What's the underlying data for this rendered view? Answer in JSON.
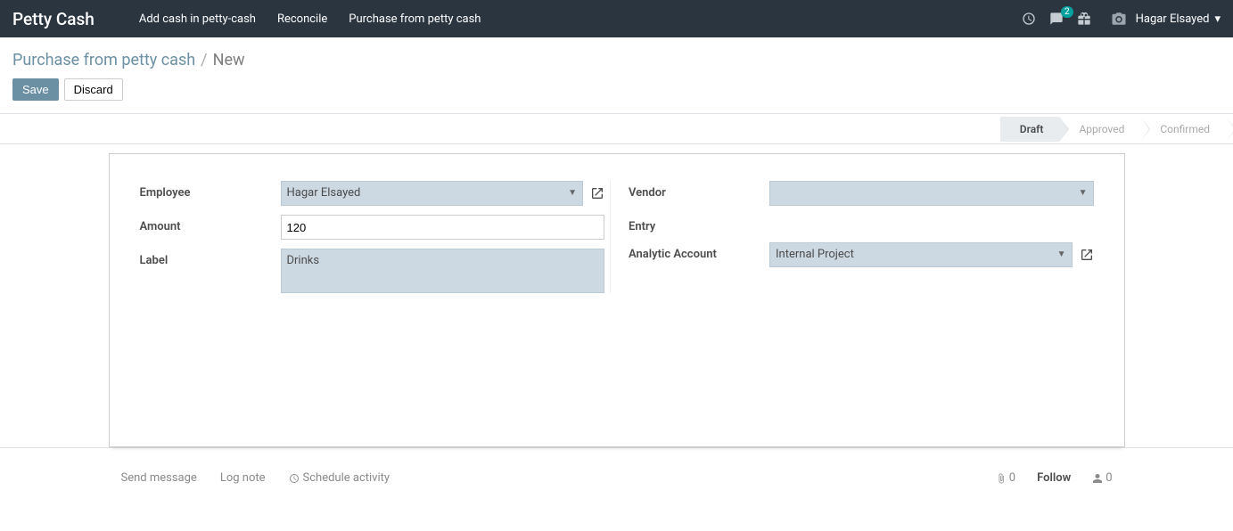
{
  "navbar": {
    "brand": "Petty Cash",
    "links": [
      "Add cash in petty-cash",
      "Reconcile",
      "Purchase from petty cash"
    ],
    "messages_badge": "2",
    "user_name": "Hagar Elsayed"
  },
  "breadcrumb": {
    "parent": "Purchase from petty cash",
    "current": "New"
  },
  "actions": {
    "save": "Save",
    "discard": "Discard"
  },
  "status": {
    "steps": [
      "Draft",
      "Approved",
      "Confirmed"
    ],
    "active_index": 0
  },
  "form": {
    "employee_label": "Employee",
    "employee_value": "Hagar Elsayed",
    "amount_label": "Amount",
    "amount_value": "120",
    "label_label": "Label",
    "label_value": "Drinks",
    "vendor_label": "Vendor",
    "vendor_value": "",
    "entry_label": "Entry",
    "entry_value": "",
    "analytic_label": "Analytic Account",
    "analytic_value": "Internal Project"
  },
  "chatter": {
    "send_message": "Send message",
    "log_note": "Log note",
    "schedule_activity": "Schedule activity",
    "attachments_count": "0",
    "follow": "Follow",
    "followers_count": "0"
  }
}
